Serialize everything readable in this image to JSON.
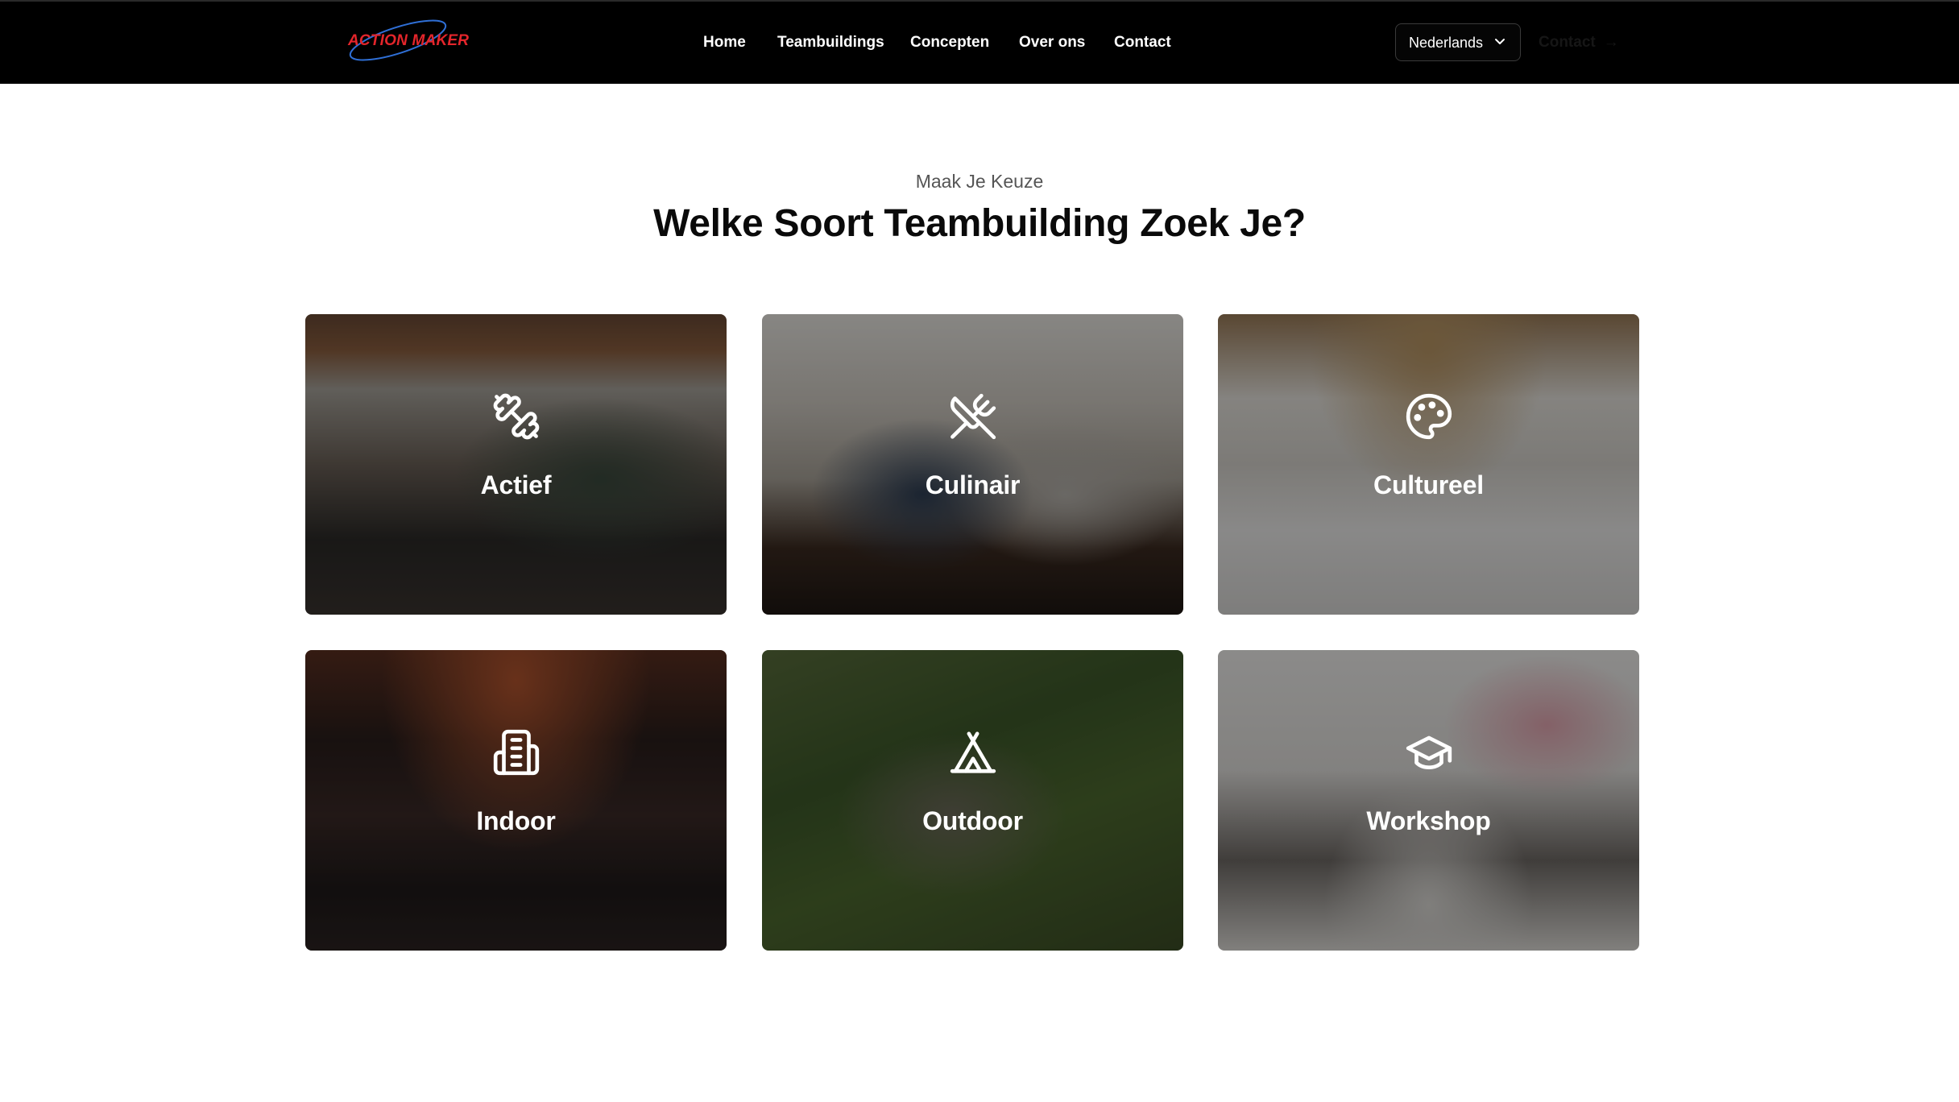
{
  "brand": {
    "logo_text": "ACTION MAKER",
    "logo_color": "#e4252b",
    "swoosh_color": "#2f6fd6"
  },
  "nav": {
    "items": [
      {
        "label": "Home"
      },
      {
        "label": "Teambuildings"
      },
      {
        "label": "Concepten"
      },
      {
        "label": "Over ons"
      },
      {
        "label": "Contact"
      }
    ],
    "language": "Nederlands",
    "cta_label": "Contact"
  },
  "section": {
    "eyebrow": "Maak Je Keuze",
    "title": "Welke Soort Teambuilding Zoek Je?"
  },
  "categories": [
    {
      "label": "Actief",
      "icon": "dumbbell-icon"
    },
    {
      "label": "Culinair",
      "icon": "utensils-crossed-icon"
    },
    {
      "label": "Cultureel",
      "icon": "palette-icon"
    },
    {
      "label": "Indoor",
      "icon": "building-icon"
    },
    {
      "label": "Outdoor",
      "icon": "tent-icon"
    },
    {
      "label": "Workshop",
      "icon": "graduation-cap-icon"
    }
  ]
}
